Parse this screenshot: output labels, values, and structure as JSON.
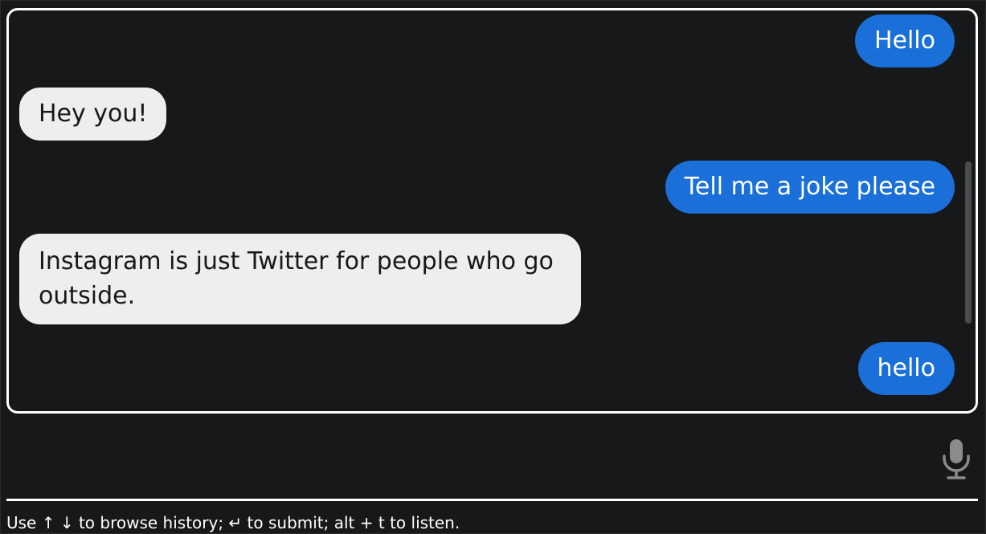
{
  "chat": {
    "messages": [
      {
        "role": "user",
        "text": "Hello"
      },
      {
        "role": "bot",
        "text": "Hey you!"
      },
      {
        "role": "user",
        "text": "Tell me a joke please"
      },
      {
        "role": "bot",
        "text": "Instagram is just Twitter for people who go outside."
      },
      {
        "role": "user",
        "text": "hello"
      }
    ]
  },
  "input": {
    "value": "",
    "placeholder": "",
    "mic_icon": "microphone-icon"
  },
  "hint": {
    "text": "Use ↑ ↓ to browse history; ↵ to submit; alt + t to listen."
  },
  "colors": {
    "background": "#17181a",
    "user_bubble": "#1a6fd8",
    "bot_bubble": "#eeeeee",
    "border": "#ffffff",
    "mic": "#8a8b8d"
  }
}
